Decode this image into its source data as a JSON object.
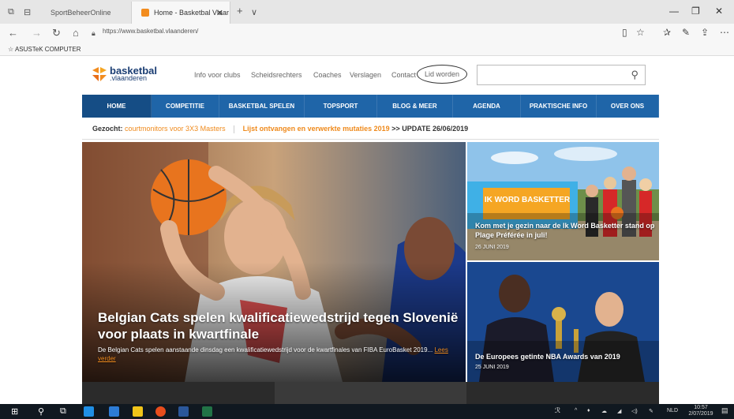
{
  "browser": {
    "tabs": [
      {
        "label": "SportBeheerOnline"
      },
      {
        "label": "Home - Basketbal Vlaar"
      }
    ],
    "new_tab": "+",
    "tab_menu": "∨",
    "url": "https://www.basketbal.vlaanderen/",
    "favorites": [
      "ASUSTeK COMPUTER"
    ]
  },
  "site": {
    "logo_line1": "basketbal",
    "logo_line2": ".vlaanderen",
    "top_links": [
      "Info voor clubs",
      "Scheidsrechters",
      "Coaches",
      "Verslagen",
      "Contact"
    ],
    "lid_worden": "Lid worden",
    "search_placeholder": "",
    "nav": [
      "HOME",
      "COMPETITIE",
      "BASKETBAL SPELEN",
      "TOPSPORT",
      "BLOG & MEER",
      "AGENDA",
      "PRAKTISCHE INFO",
      "OVER ONS"
    ],
    "ticker": {
      "label": "Gezocht:",
      "link1": "courtmonitors voor 3X3 Masters",
      "link2": "Lijst ontvangen en verwerkte mutaties 2019",
      "suffix": ">> UPDATE 26/06/2019"
    },
    "hero": {
      "title": "Belgian Cats spelen kwalificatiewedstrijd tegen Slovenië voor plaats in kwartfinale",
      "text": "De Belgian Cats spelen aanstaande dinsdag een kwalificatiewedstrijd voor de kwartfinales van FIBA EuroBasket 2019...",
      "read_more": "Lees verder"
    },
    "side": [
      {
        "title": "Kom met je gezin naar de Ik Word Basketter stand op Plage Préférée in juli!",
        "date": "26 JUNI 2019",
        "banner": "IK WORD BASKETTER"
      },
      {
        "title": "De Europees getinte NBA Awards van 2019",
        "date": "25 JUNI 2019"
      }
    ]
  },
  "taskbar": {
    "lang": "NLD",
    "time": "10:57",
    "date": "2/07/2019"
  }
}
